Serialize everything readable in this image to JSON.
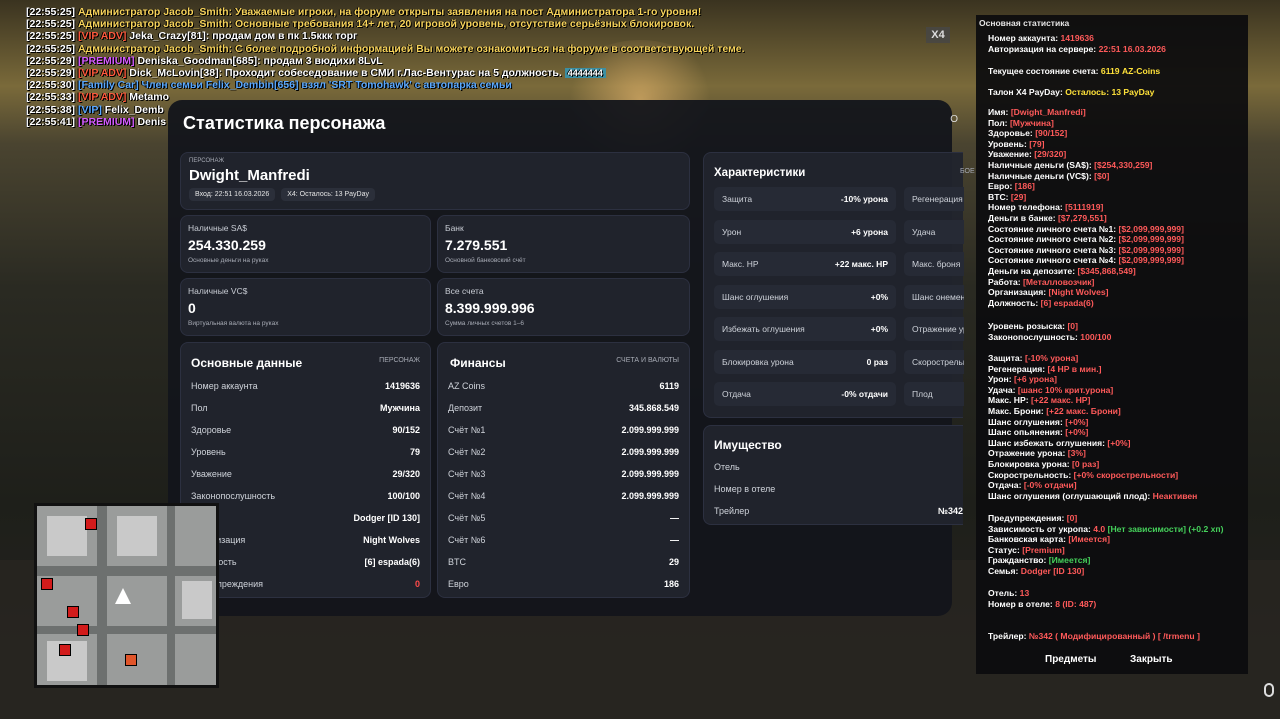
{
  "chat": [
    {
      "time": "[22:55:25]",
      "prefix": "Администратор Jacob_Smith:",
      "text": " Уважаемые игроки, на форуме открыты заявления на пост Администратора 1-го уровня!",
      "pc": "#f7d35b",
      "tc": "#f7d35b"
    },
    {
      "time": "[22:55:25]",
      "prefix": "Администратор Jacob_Smith:",
      "text": " Основные требования 14+ лет, 20 игровой уровень, отсутствие серьёзных блокировок.",
      "pc": "#f7d35b",
      "tc": "#f7d35b"
    },
    {
      "time": "[22:55:25]",
      "prefix": "[VIP ADV]",
      "text": " Jeka_Crazy[81]: продам дом в пк 1.5ккк торг",
      "pc": "#ff5a3d",
      "tc": "#ffffff"
    },
    {
      "time": "[22:55:25]",
      "prefix": "Администратор Jacob_Smith:",
      "text": " С более подробной информацией Вы можете ознакомиться на форуме в соответствующей теме.",
      "pc": "#f7d35b",
      "tc": "#f7d35b"
    },
    {
      "time": "[22:55:29]",
      "prefix": "[PREMIUM]",
      "text": " Deniska_Goodman[685]: продам 3 вюдихи 8LvL",
      "pc": "#d65cff",
      "tc": "#ffffff"
    },
    {
      "time": "[22:55:29]",
      "prefix": "[VIP ADV]",
      "text": " Dick_McLovin[38]: Проходит собеседование в СМИ г.Лас-Вентурас на 5 должность.",
      "pc": "#ff5a3d",
      "tc": "#ffffff",
      "badge": "4444444"
    },
    {
      "time": "[22:55:30]",
      "prefix": "[Family Car]",
      "text": " Член семьи Felix_Dembin[656] взял 'SRT Tomohawk' с автопарка семьи",
      "pc": "#5aa9ff",
      "tc": "#5aa9ff"
    },
    {
      "time": "[22:55:33]",
      "prefix": "[VIP ADV]",
      "text": " Metamo",
      "pc": "#ff5a3d",
      "tc": "#ffffff"
    },
    {
      "time": "[22:55:38]",
      "prefix": "[VIP]",
      "text": " Felix_Demb",
      "pc": "#5aa9ff",
      "tc": "#ffffff"
    },
    {
      "time": "[22:55:41]",
      "prefix": "[PREMIUM]",
      "text": " Denis",
      "pc": "#d65cff",
      "tc": "#ffffff"
    }
  ],
  "x4_label": "X4",
  "modal": {
    "title": "Статистика персонажа",
    "close_hint": "О",
    "hero": {
      "caption": "ПЕРСОНАЖ",
      "name": "Dwight_Manfredi",
      "chip1": "Вход: 22:51 16.03.2026",
      "chip2": "X4: Осталось: 13 PayDay"
    },
    "cash": {
      "label": "Наличные SA$",
      "value": "254.330.259",
      "sub": "Основные деньги на руках"
    },
    "bank": {
      "label": "Банк",
      "value": "7.279.551",
      "sub": "Основной банковский счёт"
    },
    "vc": {
      "label": "Наличные VC$",
      "value": "0",
      "sub": "Виртуальная валюта на руках"
    },
    "accounts": {
      "label": "Все счета",
      "value": "8.399.999.996",
      "sub": "Сумма личных счетов 1–6"
    },
    "basic": {
      "title": "Основные данные",
      "tag": "ПЕРСОНАЖ",
      "rows": [
        {
          "k": "Номер аккаунта",
          "v": "1419636"
        },
        {
          "k": "Пол",
          "v": "Мужчина"
        },
        {
          "k": "Здоровье",
          "v": "90/152"
        },
        {
          "k": "Уровень",
          "v": "79"
        },
        {
          "k": "Уважение",
          "v": "29/320"
        },
        {
          "k": "Законопослушность",
          "v": "100/100"
        },
        {
          "k": "Семья",
          "v": "Dodger [ID 130]"
        },
        {
          "k": "Организация",
          "v": "Night Wolves"
        },
        {
          "k": "Должность",
          "v": "[6] espada(6)"
        },
        {
          "k": "Предупреждения",
          "v": "0",
          "red": true
        }
      ]
    },
    "finance": {
      "title": "Финансы",
      "tag": "СЧЕТА И ВАЛЮТЫ",
      "rows": [
        {
          "k": "AZ Coins",
          "v": "6119"
        },
        {
          "k": "Депозит",
          "v": "345.868.549"
        },
        {
          "k": "Счёт №1",
          "v": "2.099.999.999"
        },
        {
          "k": "Счёт №2",
          "v": "2.099.999.999"
        },
        {
          "k": "Счёт №3",
          "v": "2.099.999.999"
        },
        {
          "k": "Счёт №4",
          "v": "2.099.999.999"
        },
        {
          "k": "Счёт №5",
          "v": "—"
        },
        {
          "k": "Счёт №6",
          "v": "—"
        },
        {
          "k": "BTC",
          "v": "29"
        },
        {
          "k": "Евро",
          "v": "186"
        }
      ]
    },
    "chars": {
      "title": "Характеристики",
      "tag": "БОЕ",
      "left": [
        {
          "k": "Защита",
          "v": "-10% урона"
        },
        {
          "k": "Урон",
          "v": "+6 урона"
        },
        {
          "k": "Макс. HP",
          "v": "+22 макс. HP"
        },
        {
          "k": "Шанс оглушения",
          "v": "+0%"
        },
        {
          "k": "Избежать оглушения",
          "v": "+0%"
        },
        {
          "k": "Блокировка урона",
          "v": "0 раз"
        },
        {
          "k": "Отдача",
          "v": "-0% отдачи"
        }
      ],
      "right": [
        "Регенерация",
        "Удача",
        "Макс. броня",
        "Шанс онемения",
        "Отражение уро",
        "Скорострельно",
        "Плод"
      ]
    },
    "property": {
      "title": "Имущество",
      "rows": [
        {
          "k": "Отель",
          "v": ""
        },
        {
          "k": "Номер в отеле",
          "v": ""
        },
        {
          "k": "Трейлер",
          "v": "№342"
        }
      ]
    }
  },
  "rp": {
    "header": "Основная статистика",
    "top": [
      {
        "k": "Номер аккаунта:",
        "v": "1419636",
        "vc": "r"
      },
      {
        "k": "Авторизация на сервере:",
        "v": "22:51 16.03.2026",
        "vc": "r"
      }
    ],
    "balance": {
      "k": "Текущее состояние счета:",
      "v": "6119 AZ-Coins"
    },
    "payday": {
      "k": "Талон X4 PayDay:",
      "v": "Осталось: 13 PayDay"
    },
    "main": [
      {
        "k": "Имя:",
        "v": "[Dwight_Manfredi]"
      },
      {
        "k": "Пол:",
        "v": "[Мужчина]"
      },
      {
        "k": "Здоровье:",
        "v": "[90/152]"
      },
      {
        "k": "Уровень:",
        "v": "[79]"
      },
      {
        "k": "Уважение:",
        "v": "[29/320]"
      },
      {
        "k": "Наличные деньги (SA$):",
        "v": "[$254,330,259]"
      },
      {
        "k": "Наличные деньги (VC$):",
        "v": "[$0]"
      },
      {
        "k": "Евро:",
        "v": "[186]"
      },
      {
        "k": "BTC:",
        "v": "[29]"
      },
      {
        "k": "Номер телефона:",
        "v": "[5111919]"
      },
      {
        "k": "Деньги в банке:",
        "v": "[$7,279,551]"
      },
      {
        "k": "Состояние личного счета №1:",
        "v": "[$2,099,999,999]"
      },
      {
        "k": "Состояние личного счета №2:",
        "v": "[$2,099,999,999]"
      },
      {
        "k": "Состояние личного счета №3:",
        "v": "[$2,099,999,999]"
      },
      {
        "k": "Состояние личного счета №4:",
        "v": "[$2,099,999,999]"
      },
      {
        "k": "Деньги на депозите:",
        "v": "[$345,868,549]"
      },
      {
        "k": "Работа:",
        "v": "[Металловозчик]"
      },
      {
        "k": "Организация:",
        "v": "[Night Wolves]"
      },
      {
        "k": "Должность:",
        "v": "[6] espada(6)"
      }
    ],
    "wanted": [
      {
        "k": "Уровень розыска:",
        "v": "[0]"
      },
      {
        "k": "Законопослушность:",
        "v": "100/100"
      }
    ],
    "skills": [
      {
        "k": "Защита:",
        "v": "[-10% урона]"
      },
      {
        "k": "Регенерация:",
        "v": "[4 HP в мин.]"
      },
      {
        "k": "Урон:",
        "v": "[+6 урона]"
      },
      {
        "k": "Удача:",
        "v": "[шанс 10% крит.урона]"
      },
      {
        "k": "Макс. HP:",
        "v": "[+22 макс. HP]"
      },
      {
        "k": "Макс. Брони:",
        "v": "[+22 макс. Брони]"
      },
      {
        "k": "Шанс оглушения:",
        "v": "[+0%]"
      },
      {
        "k": "Шанс опьянения:",
        "v": "[+0%]"
      },
      {
        "k": "Шанс избежать оглушения:",
        "v": "[+0%]"
      },
      {
        "k": "Отражение урона:",
        "v": "[3%]"
      },
      {
        "k": "Блокировка урона:",
        "v": "[0 раз]"
      },
      {
        "k": "Скорострельность:",
        "v": "[+0% скорострельности]"
      },
      {
        "k": "Отдача:",
        "v": "[-0% отдачи]"
      },
      {
        "k": "Шанс оглушения (оглушающий плод):",
        "v": "Неактивен"
      }
    ],
    "status": [
      {
        "k": "Предупреждения:",
        "v": "[0]"
      },
      {
        "k": "Зависимость от укропа:",
        "v": "4.0",
        "extra": "[Нет зависимости] (+0.2 хп)"
      },
      {
        "k": "Банковская карта:",
        "v": "[Имеется]"
      },
      {
        "k": "Статус:",
        "v": "[Premium]"
      },
      {
        "k": "Гражданство:",
        "v": "[Имеется]",
        "vc": "g"
      },
      {
        "k": "Семья:",
        "v": "Dodger [ID 130]"
      }
    ],
    "hotel": [
      {
        "k": "Отель:",
        "v": "13"
      },
      {
        "k": "Номер в отеле:",
        "v": "8 (ID: 487)"
      }
    ],
    "trailer": {
      "k": "Трейлер:",
      "v": "№342 ( Модифицированный ) [ /trmenu ]"
    },
    "btn_items": "Предметы",
    "btn_close": "Закрыть"
  },
  "colors": {
    "accent_red": "#ff5a5a",
    "accent_green": "#45d15b",
    "accent_yellow": "#ffe23a"
  }
}
